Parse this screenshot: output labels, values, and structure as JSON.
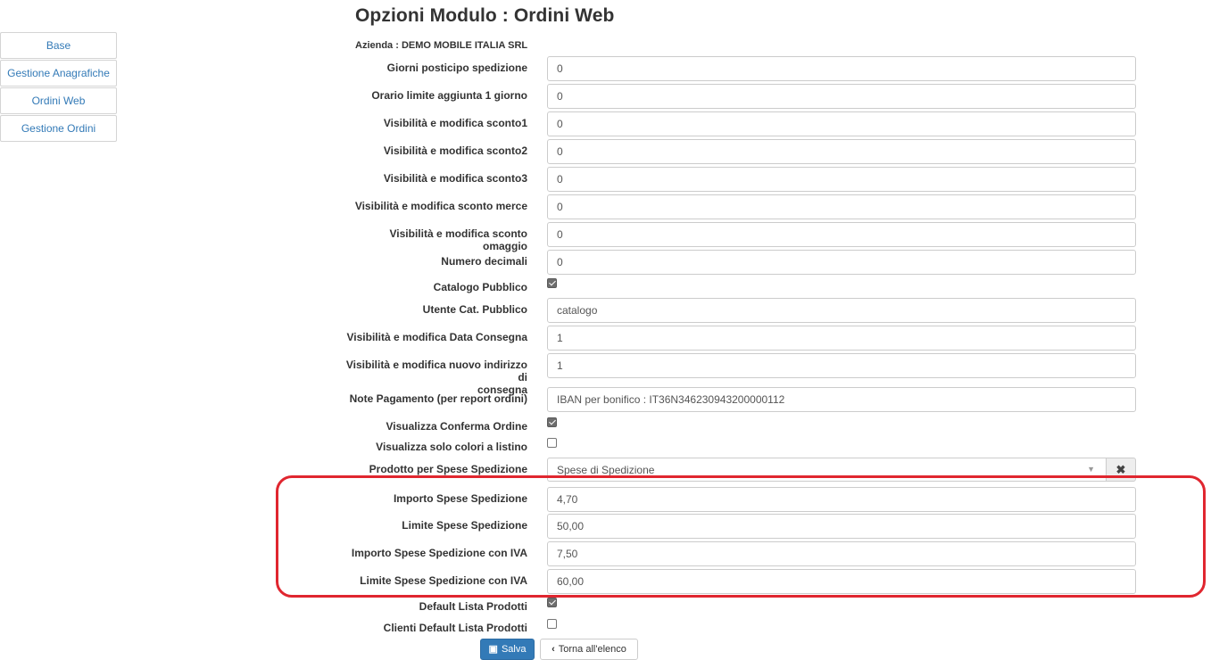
{
  "sidebar": {
    "items": [
      {
        "label": "Base"
      },
      {
        "label": "Gestione Anagrafiche"
      },
      {
        "label": "Ordini Web"
      },
      {
        "label": "Gestione Ordini"
      }
    ]
  },
  "header": {
    "title": "Opzioni Modulo : Ordini Web",
    "company": "Azienda : DEMO MOBILE ITALIA SRL"
  },
  "form": {
    "giorni_posticipo": {
      "label": "Giorni posticipo spedizione",
      "value": "0"
    },
    "orario_limite": {
      "label": "Orario limite aggiunta 1 giorno",
      "value": "0"
    },
    "sconto1": {
      "label": "Visibilità e modifica sconto1",
      "value": "0"
    },
    "sconto2": {
      "label": "Visibilità e modifica sconto2",
      "value": "0"
    },
    "sconto3": {
      "label": "Visibilità e modifica sconto3",
      "value": "0"
    },
    "sconto_merce": {
      "label": "Visibilità e modifica sconto merce",
      "value": "0"
    },
    "sconto_omaggio": {
      "label": "Visibilità e modifica sconto omaggio",
      "value": "0"
    },
    "numero_decimali": {
      "label": "Numero decimali",
      "value": "0"
    },
    "catalogo_pubblico": {
      "label": "Catalogo Pubblico",
      "checked": true
    },
    "utente_cat_pubblico": {
      "label": "Utente Cat. Pubblico",
      "value": "catalogo"
    },
    "data_consegna": {
      "label": "Visibilità e modifica Data Consegna",
      "value": "1"
    },
    "nuovo_indirizzo": {
      "label_line1": "Visibilità e modifica nuovo indirizzo di",
      "label_line2": "consegna",
      "value": "1"
    },
    "note_pagamento": {
      "label": "Note Pagamento (per report ordini)",
      "value": "IBAN per bonifico : IT36N346230943200000112"
    },
    "conferma_ordine": {
      "label": "Visualizza Conferma Ordine",
      "checked": true
    },
    "solo_colori": {
      "label": "Visualizza solo colori a listino",
      "checked": false
    },
    "prodotto_spese": {
      "label": "Prodotto per Spese Spedizione",
      "value": "Spese di Spedizione",
      "clear_icon": "times-icon"
    },
    "importo_spese": {
      "label": "Importo Spese Spedizione",
      "value": "4,70"
    },
    "limite_spese": {
      "label": "Limite Spese Spedizione",
      "value": "50,00"
    },
    "importo_spese_iva": {
      "label": "Importo Spese Spedizione con IVA",
      "value": "7,50"
    },
    "limite_spese_iva": {
      "label": "Limite Spese Spedizione con IVA",
      "value": "60,00"
    },
    "default_lista": {
      "label": "Default Lista Prodotti",
      "checked": true
    },
    "clienti_default_lista": {
      "label": "Clienti Default Lista Prodotti",
      "checked": false
    }
  },
  "actions": {
    "save_label": "Salva",
    "back_label": "Torna all'elenco"
  },
  "colors": {
    "primary": "#337ab7",
    "highlight": "#e0262f"
  }
}
